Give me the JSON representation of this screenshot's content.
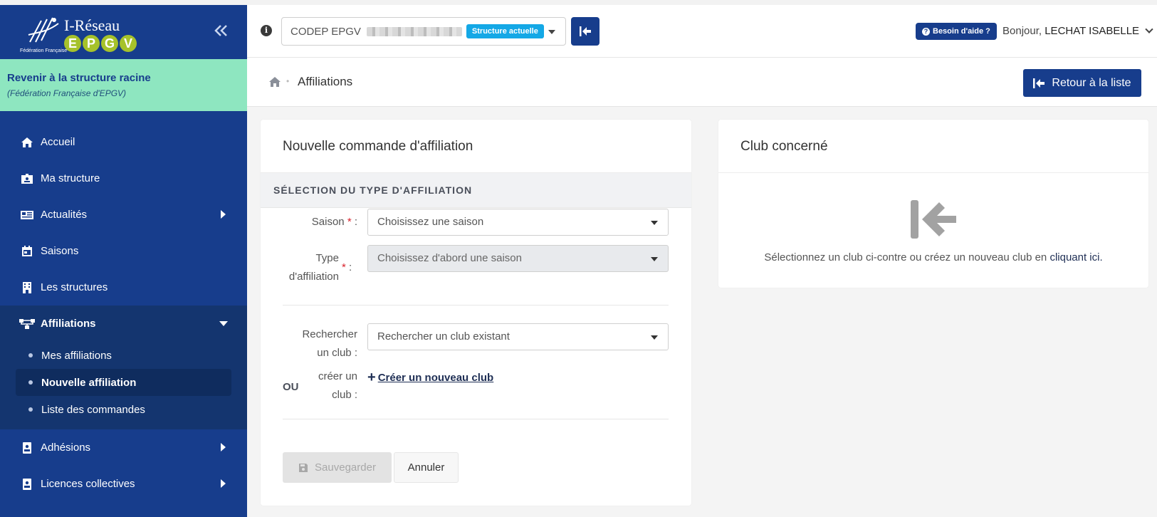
{
  "sidebar": {
    "logo_title": "I-Réseau",
    "logo_letters": [
      "E",
      "P",
      "G",
      "V"
    ],
    "logo_subtitle": "Fédération Française",
    "root_link_title": "Revenir à la structure racine",
    "root_link_subtitle": "(Fédération Française d'EPGV)",
    "items": [
      {
        "label": "Accueil",
        "icon": "home-icon"
      },
      {
        "label": "Ma structure",
        "icon": "id-card-icon"
      },
      {
        "label": "Actualités",
        "icon": "newspaper-icon"
      },
      {
        "label": "Saisons",
        "icon": "calendar-icon"
      },
      {
        "label": "Les structures",
        "icon": "building-icon"
      },
      {
        "label": "Affiliations",
        "icon": "sitemap-icon"
      },
      {
        "label": "Adhésions",
        "icon": "id-badge-icon"
      },
      {
        "label": "Licences collectives",
        "icon": "id-badge-icon"
      }
    ],
    "affiliations_sub": [
      {
        "label": "Mes affiliations"
      },
      {
        "label": "Nouvelle affiliation"
      },
      {
        "label": "Liste des commandes"
      }
    ]
  },
  "topbar": {
    "structure_prefix": "CODEP EPGV",
    "structure_badge": "Structure actuelle",
    "help_label": "Besoin d'aide ?",
    "greeting_prefix": "Bonjour,",
    "user_name": "LECHAT ISABELLE"
  },
  "breadcrumb": {
    "title": "Affiliations",
    "back_button": "Retour à la liste"
  },
  "form_card": {
    "title": "Nouvelle commande d'affiliation",
    "section": "SÉLECTION DU TYPE D'AFFILIATION",
    "saison_label": "Saison",
    "saison_placeholder": "Choisissez une saison",
    "type_label_1": "Type",
    "type_label_2": "d'affiliation",
    "type_placeholder": "Choisissez d'abord une saison",
    "search_label_1": "Rechercher",
    "search_label_2": "un club :",
    "search_placeholder": "Rechercher un club existant",
    "ou": "OU",
    "create_label_1": "créer un",
    "create_label_2": "club :",
    "create_link": "Créer un nouveau club",
    "save_button": "Sauvegarder",
    "cancel_button": "Annuler"
  },
  "club_card": {
    "title": "Club concerné",
    "empty_text": "Sélectionnez un club ci-contre ou créez un nouveau club en",
    "empty_link": "cliquant ici."
  },
  "colors": {
    "sidebar": "#173d8c",
    "accent_green": "#8ee6c0",
    "badge_blue": "#14a8e6",
    "required": "#d9232d"
  }
}
